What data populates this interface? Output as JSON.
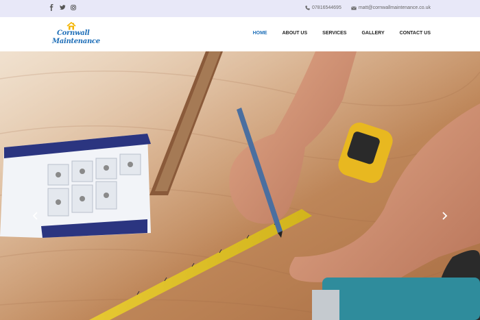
{
  "topbar": {
    "social_icons": [
      "facebook-icon",
      "twitter-icon",
      "instagram-icon"
    ],
    "phone": "07816544695",
    "email": "matt@cornwallmaintenance.co.uk"
  },
  "brand": {
    "line1": "Cornwall",
    "line2": "Maintenance"
  },
  "nav": {
    "items": [
      {
        "label": "HOME",
        "active": true
      },
      {
        "label": "ABOUT US",
        "active": false
      },
      {
        "label": "SERVICES",
        "active": false
      },
      {
        "label": "GALLERY",
        "active": false
      },
      {
        "label": "CONTACT US",
        "active": false
      }
    ]
  },
  "colors": {
    "topbar_bg": "#e8e8f8",
    "accent": "#1f6fb8",
    "logo_gold": "#f4b400"
  },
  "slider": {
    "prev_icon": "chevron-left-icon",
    "next_icon": "chevron-right-icon"
  }
}
